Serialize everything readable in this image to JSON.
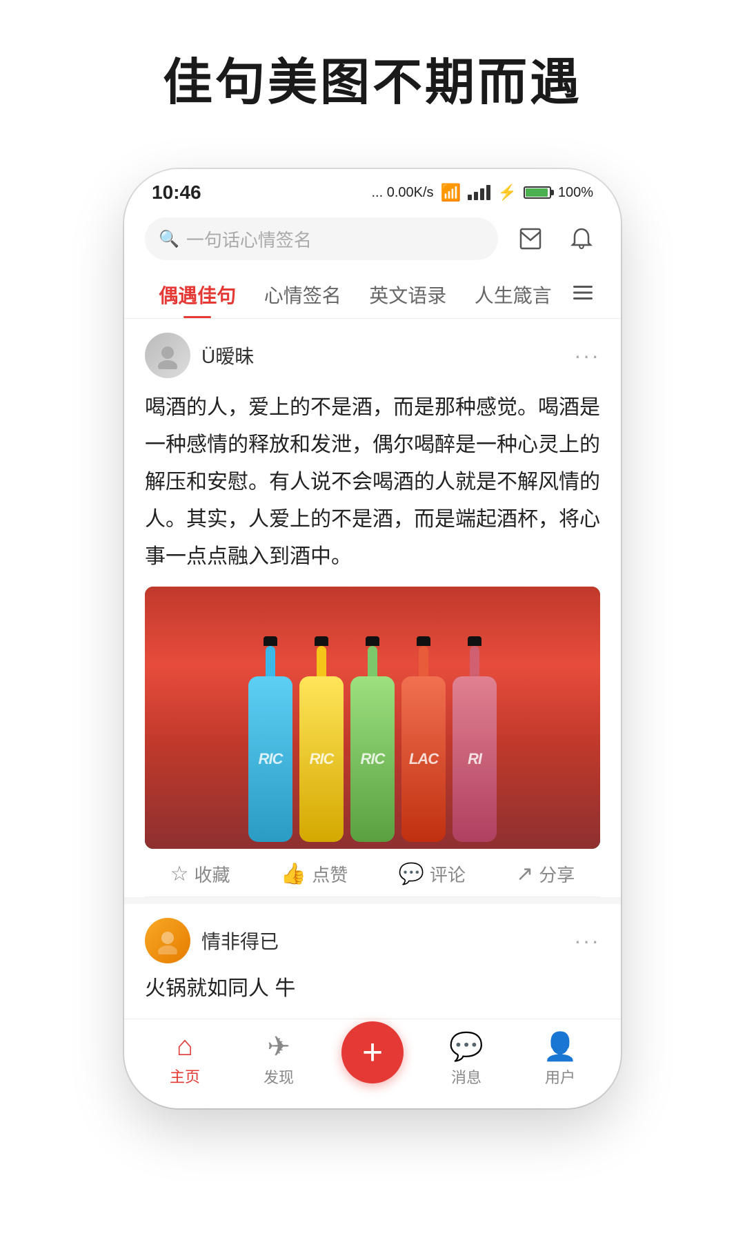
{
  "headline": "佳句美图不期而遇",
  "status_bar": {
    "time": "10:46",
    "network": "... 0.00K/s",
    "battery": "100%"
  },
  "search": {
    "placeholder": "一句话心情签名"
  },
  "tabs": [
    {
      "label": "偶遇佳句",
      "active": true
    },
    {
      "label": "心情签名",
      "active": false
    },
    {
      "label": "英文语录",
      "active": false
    },
    {
      "label": "人生箴言",
      "active": false
    }
  ],
  "card1": {
    "username": "Ü暧昧",
    "text": "喝酒的人，爱上的不是酒，而是那种感觉。喝酒是一种感情的释放和发泄，偶尔喝醉是一种心灵上的解压和安慰。有人说不会喝酒的人就是不解风情的人。其实，人爱上的不是酒，而是端起酒杯，将心事一点点融入到酒中。",
    "actions": {
      "collect": "收藏",
      "like": "点赞",
      "comment": "评论",
      "share": "分享"
    }
  },
  "card2": {
    "username": "情非得已",
    "text": "火锅就如同人 牛"
  },
  "bottles": [
    {
      "color": "#3bb8e8",
      "label": "RIC"
    },
    {
      "color": "#f5c518",
      "label": "RIC"
    },
    {
      "color": "#7dc86a",
      "label": "RIC"
    },
    {
      "color": "#e85c3a",
      "label": "LAC"
    },
    {
      "color": "#e07080",
      "label": "RI"
    }
  ],
  "nav": {
    "items": [
      {
        "label": "主页",
        "active": true
      },
      {
        "label": "发现",
        "active": false
      },
      {
        "label": "",
        "active": false
      },
      {
        "label": "消息",
        "active": false
      },
      {
        "label": "用户",
        "active": false
      }
    ]
  }
}
